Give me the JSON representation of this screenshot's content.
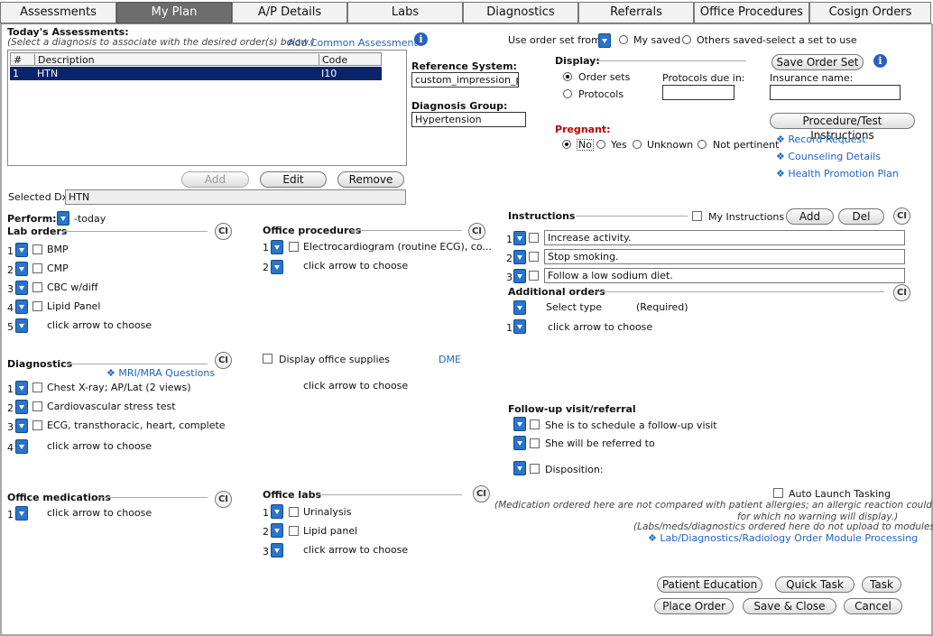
{
  "tabs": [
    "Assessments",
    "My Plan",
    "A/P Details",
    "Labs",
    "Diagnostics",
    "Referrals",
    "Office Procedures",
    "Cosign Orders"
  ],
  "assess": {
    "title": "Today's Assessments:",
    "hint": "(Select a diagnosis to associate with the desired order(s) below.)",
    "add_common": "Add Common Assessment",
    "headers": [
      "#",
      "Description",
      "Code"
    ],
    "row": {
      "num": "1",
      "desc": "HTN",
      "code": "I10"
    },
    "btn_add": "Add",
    "btn_edit": "Edit",
    "btn_remove": "Remove",
    "selected_label": "Selected Dx:",
    "selected_value": "HTN"
  },
  "ref": {
    "label": "Reference System:",
    "value": "custom_impression_pl",
    "dg_label": "Diagnosis Group:",
    "dg_value": "Hypertension"
  },
  "orderset": {
    "label": "Use order set from:",
    "my_saved": "My saved",
    "others_saved": "Others saved",
    "hint": "-select a set to use",
    "display_label": "Display:",
    "opt_sets": "Order sets",
    "opt_protocols": "Protocols",
    "protocols_due": "Protocols due in:",
    "save_btn": "Save Order Set",
    "insurance": "Insurance name:"
  },
  "pregnant": {
    "label": "Pregnant:",
    "no": "No",
    "yes": "Yes",
    "unknown": "Unknown",
    "not_pertinent": "Not pertinent"
  },
  "proc_btn": "Procedure/Test Instructions",
  "links": [
    "Record Request",
    "Counseling Details",
    "Health Promotion Plan"
  ],
  "perform": {
    "label": "Perform:",
    "value": "-today"
  },
  "lab_orders": {
    "title": "Lab orders",
    "items": [
      "BMP",
      "CMP",
      "CBC w/diff",
      "Lipid Panel"
    ],
    "choose": "click arrow to choose",
    "nums": [
      "1",
      "2",
      "3",
      "4",
      "5"
    ]
  },
  "office_proc": {
    "title": "Office procedures",
    "items": [
      "Electrocardiogram (routine ECG), co..."
    ],
    "choose": "click arrow to choose",
    "nums": [
      "1",
      "2"
    ]
  },
  "instructions": {
    "title": "Instructions",
    "my_label": "My Instructions",
    "add": "Add",
    "del": "Del",
    "items": [
      "Increase activity.",
      "Stop smoking.",
      "Follow a low sodium diet."
    ],
    "nums": [
      "1",
      "2",
      "3"
    ]
  },
  "additional": {
    "title": "Additional orders",
    "select_type": "Select type",
    "required": "(Required)",
    "choose": "click arrow to choose",
    "num": "1"
  },
  "diagnostics": {
    "title": "Diagnostics",
    "mri": "MRI/MRA Questions",
    "items": [
      "Chest X-ray; AP/Lat (2 views)",
      "Cardiovascular stress test",
      "ECG, transthoracic, heart, complete"
    ],
    "choose": "click arrow to choose",
    "nums": [
      "1",
      "2",
      "3",
      "4"
    ]
  },
  "supplies": {
    "label": "Display office supplies",
    "dme": "DME",
    "choose": "click arrow to choose"
  },
  "followup": {
    "title": "Follow-up visit/referral",
    "items": [
      "She is to schedule a follow-up visit",
      "She will be referred to",
      "Disposition:"
    ]
  },
  "office_meds": {
    "title": "Office medications",
    "choose": "click arrow to choose",
    "num": "1"
  },
  "office_labs": {
    "title": "Office labs",
    "items": [
      "Urinalysis",
      "Lipid panel"
    ],
    "choose": "click arrow to choose",
    "nums": [
      "1",
      "2",
      "3"
    ]
  },
  "auto_launch": "Auto Launch Tasking",
  "notes": {
    "note1": "(Medication ordered here are not compared with patient allergies; an allergic reaction could occur",
    "note2": "for which no warning will display.)",
    "note3": "(Labs/meds/diagnostics ordered here do not upload to modules.)",
    "module_link": "Lab/Diagnostics/Radiology Order Module Processing"
  },
  "bottom": {
    "patient_ed": "Patient Education",
    "quick_task": "Quick Task",
    "task": "Task",
    "place_order": "Place Order",
    "save_close": "Save & Close",
    "cancel": "Cancel"
  },
  "icons": {
    "ci_text": "CI",
    "info_text": "i",
    "bullet": "❖"
  },
  "colors": {
    "accent": "#2a74c9",
    "link": "#1f63c6",
    "selected_row": "#0a246a",
    "pregnant": "#c00000"
  }
}
